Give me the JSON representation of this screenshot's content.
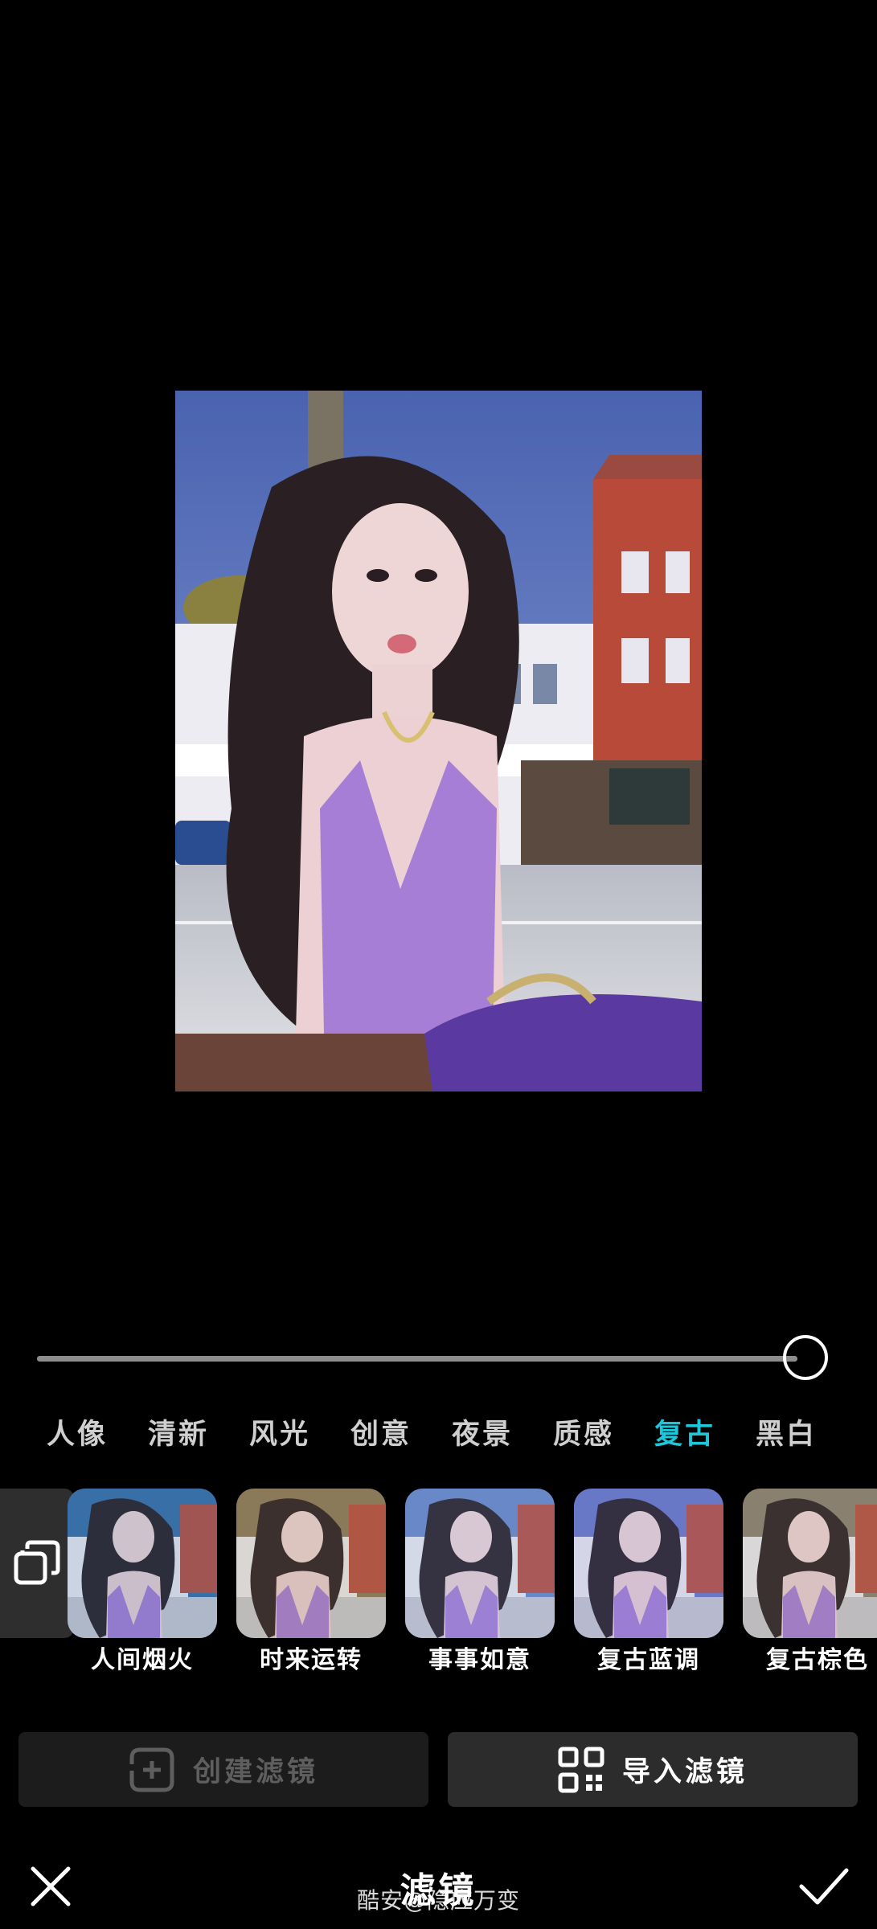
{
  "slider": {
    "value_percent": 100
  },
  "tabs": [
    {
      "label": "人像",
      "active": false
    },
    {
      "label": "清新",
      "active": false
    },
    {
      "label": "风光",
      "active": false
    },
    {
      "label": "创意",
      "active": false
    },
    {
      "label": "夜景",
      "active": false
    },
    {
      "label": "质感",
      "active": false
    },
    {
      "label": "复古",
      "active": true
    },
    {
      "label": "黑白",
      "active": false
    }
  ],
  "filters": [
    {
      "label": "人间烟火",
      "tint": "#3a6fa8"
    },
    {
      "label": "时来运转",
      "tint": "#8a7a5a"
    },
    {
      "label": "事事如意",
      "tint": "#6a88c8"
    },
    {
      "label": "复古蓝调",
      "tint": "#6a78c6"
    },
    {
      "label": "复古棕色",
      "tint": "#8a8070"
    }
  ],
  "actions": {
    "create_label": "创建滤镜",
    "import_label": "导入滤镜"
  },
  "footer": {
    "title": "滤镜",
    "watermark": "酷安@隐应万变"
  },
  "colors": {
    "accent": "#1fc6d9",
    "background": "#000000"
  },
  "icons": {
    "compare": "layers-icon",
    "create": "add-square-icon",
    "import": "qr-code-icon",
    "close": "close-icon",
    "confirm": "check-icon"
  }
}
